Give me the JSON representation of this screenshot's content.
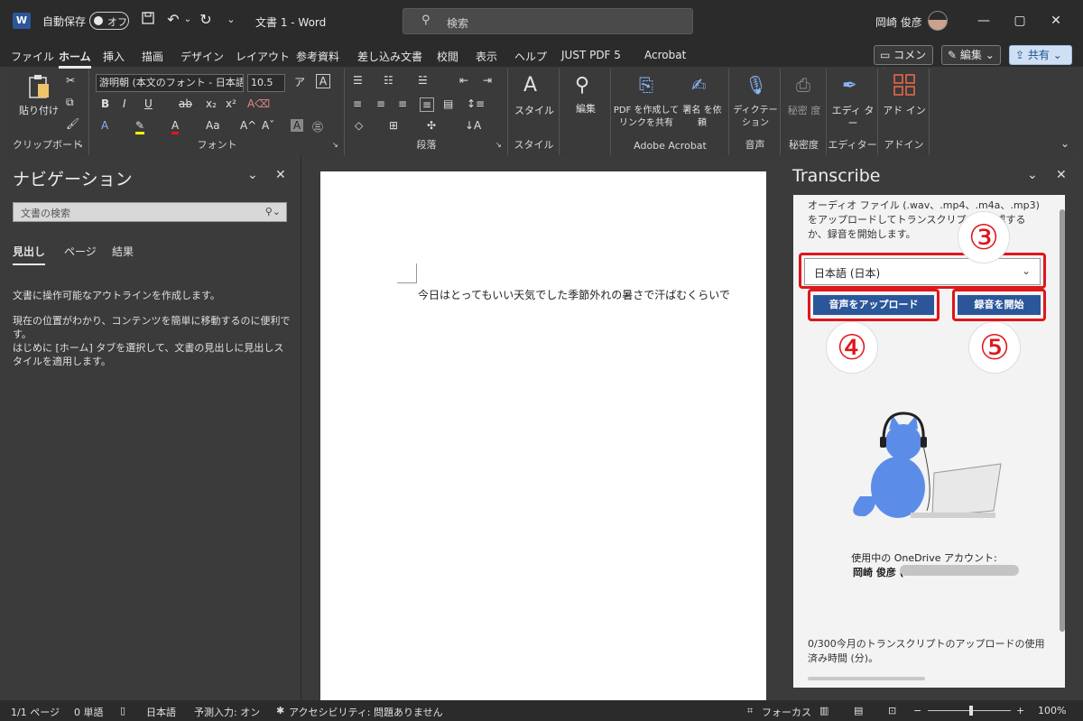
{
  "titlebar": {
    "autosave_label": "自動保存",
    "autosave_state": "オフ",
    "doc_title": "文書 1  -  Word",
    "search_placeholder": "検索",
    "user_name": "岡崎 俊彦"
  },
  "menu": {
    "tabs": [
      "ファイル",
      "ホーム",
      "挿入",
      "描画",
      "デザイン",
      "レイアウト",
      "参考資料",
      "差し込み文書",
      "校閲",
      "表示",
      "ヘルプ",
      "JUST PDF 5",
      "Acrobat"
    ],
    "active_tab": "ホーム",
    "comment_button": "コメント",
    "edit_button": "編集",
    "share_button": "共有"
  },
  "ribbon": {
    "clipboard": {
      "paste_label": "貼り付け",
      "group_label": "クリップボード"
    },
    "font": {
      "font_name": "游明朝 (本文のフォント - 日本語)",
      "font_size": "10.5",
      "group_label": "フォント"
    },
    "paragraph": {
      "group_label": "段落"
    },
    "styles": {
      "style_label": "スタイル",
      "group_label": "スタイル"
    },
    "editing": {
      "label": "編集"
    },
    "acrobat": {
      "pdf_share_label": "PDF を作成して リンクを共有",
      "sign_label": "署名 を依頼",
      "group_label": "Adobe Acrobat"
    },
    "voice": {
      "dictate_label": "ディクテー ション",
      "group_label": "音声"
    },
    "sensitivity": {
      "label": "秘密 度",
      "group_label": "秘密度"
    },
    "editor": {
      "label": "エディ ター",
      "group_label": "エディター"
    },
    "addins": {
      "label": "アド イン",
      "group_label": "アドイン"
    }
  },
  "navigation": {
    "title": "ナビゲーション",
    "search_placeholder": "文書の検索",
    "tabs": [
      "見出し",
      "ページ",
      "結果"
    ],
    "info_lines": [
      "文書に操作可能なアウトラインを作成します。",
      "現在の位置がわかり、コンテンツを簡単に移動するのに便利です。",
      "はじめに [ホーム] タブを選択して、文書の見出しに見出しスタイルを適用します。"
    ]
  },
  "document": {
    "first_line": "今日はとってもいい天気でした季節外れの暑さで汗ばむくらいで"
  },
  "transcribe": {
    "title": "Transcribe",
    "description": "オーディオ ファイル (.wav、.mp4、.m4a、.mp3) をアップロードしてトランスクリプトを作成するか、録音を開始します。",
    "language": "日本語 (日本)",
    "upload_button": "音声をアップロード",
    "record_button": "録音を開始",
    "marker_3": "③",
    "marker_4": "④",
    "marker_5": "⑤",
    "account_label": "使用中の OneDrive アカウント:",
    "account_name": "岡崎 俊彦 (",
    "usage_text": "0/300今月のトランスクリプトのアップロードの使用済み時間 (分)。"
  },
  "statusbar": {
    "page": "1/1 ページ",
    "words": "0 単語",
    "language": "日本語",
    "predictive": "予測入力: オン",
    "accessibility": "アクセシビリティ: 問題ありません",
    "focus": "フォーカス",
    "zoom": "100%"
  },
  "colors": {
    "accent": "#2b579a",
    "highlight_red": "#e0161b"
  }
}
